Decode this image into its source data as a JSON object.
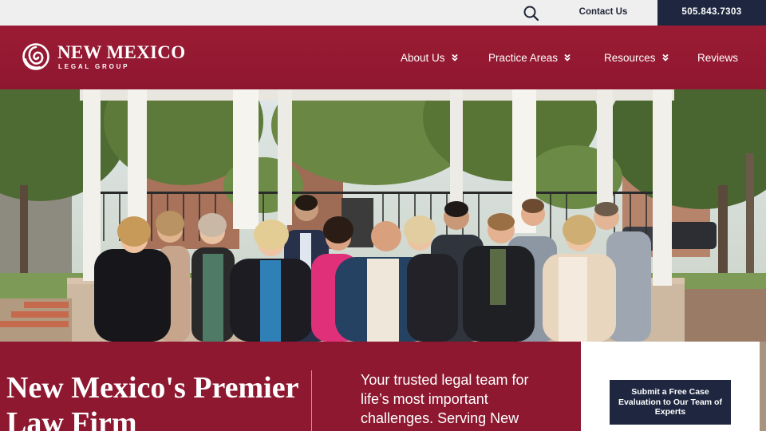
{
  "topbar": {
    "search_icon": "search-icon",
    "contact_label": "Contact Us",
    "phone": "505.843.7303"
  },
  "header": {
    "logo_name": "NEW MEXICO",
    "logo_sub": "LEGAL GROUP",
    "nav": [
      {
        "label": "About Us",
        "has_dropdown": true
      },
      {
        "label": "Practice Areas",
        "has_dropdown": true
      },
      {
        "label": "Resources",
        "has_dropdown": true
      },
      {
        "label": "Reviews",
        "has_dropdown": false
      }
    ]
  },
  "hero": {
    "image": "team-photo-gazebo-plaza"
  },
  "intro": {
    "headline": "New Mexico's Premier Law Firm",
    "tagline": "Your trusted legal team for life’s most important challenges. Serving New"
  },
  "cta": {
    "label": "Submit a Free Case Evaluation to Our Team of Experts"
  },
  "colors": {
    "brand_red": "#9b1b34",
    "navy": "#1f2740",
    "topbar_bg": "#efefef"
  }
}
